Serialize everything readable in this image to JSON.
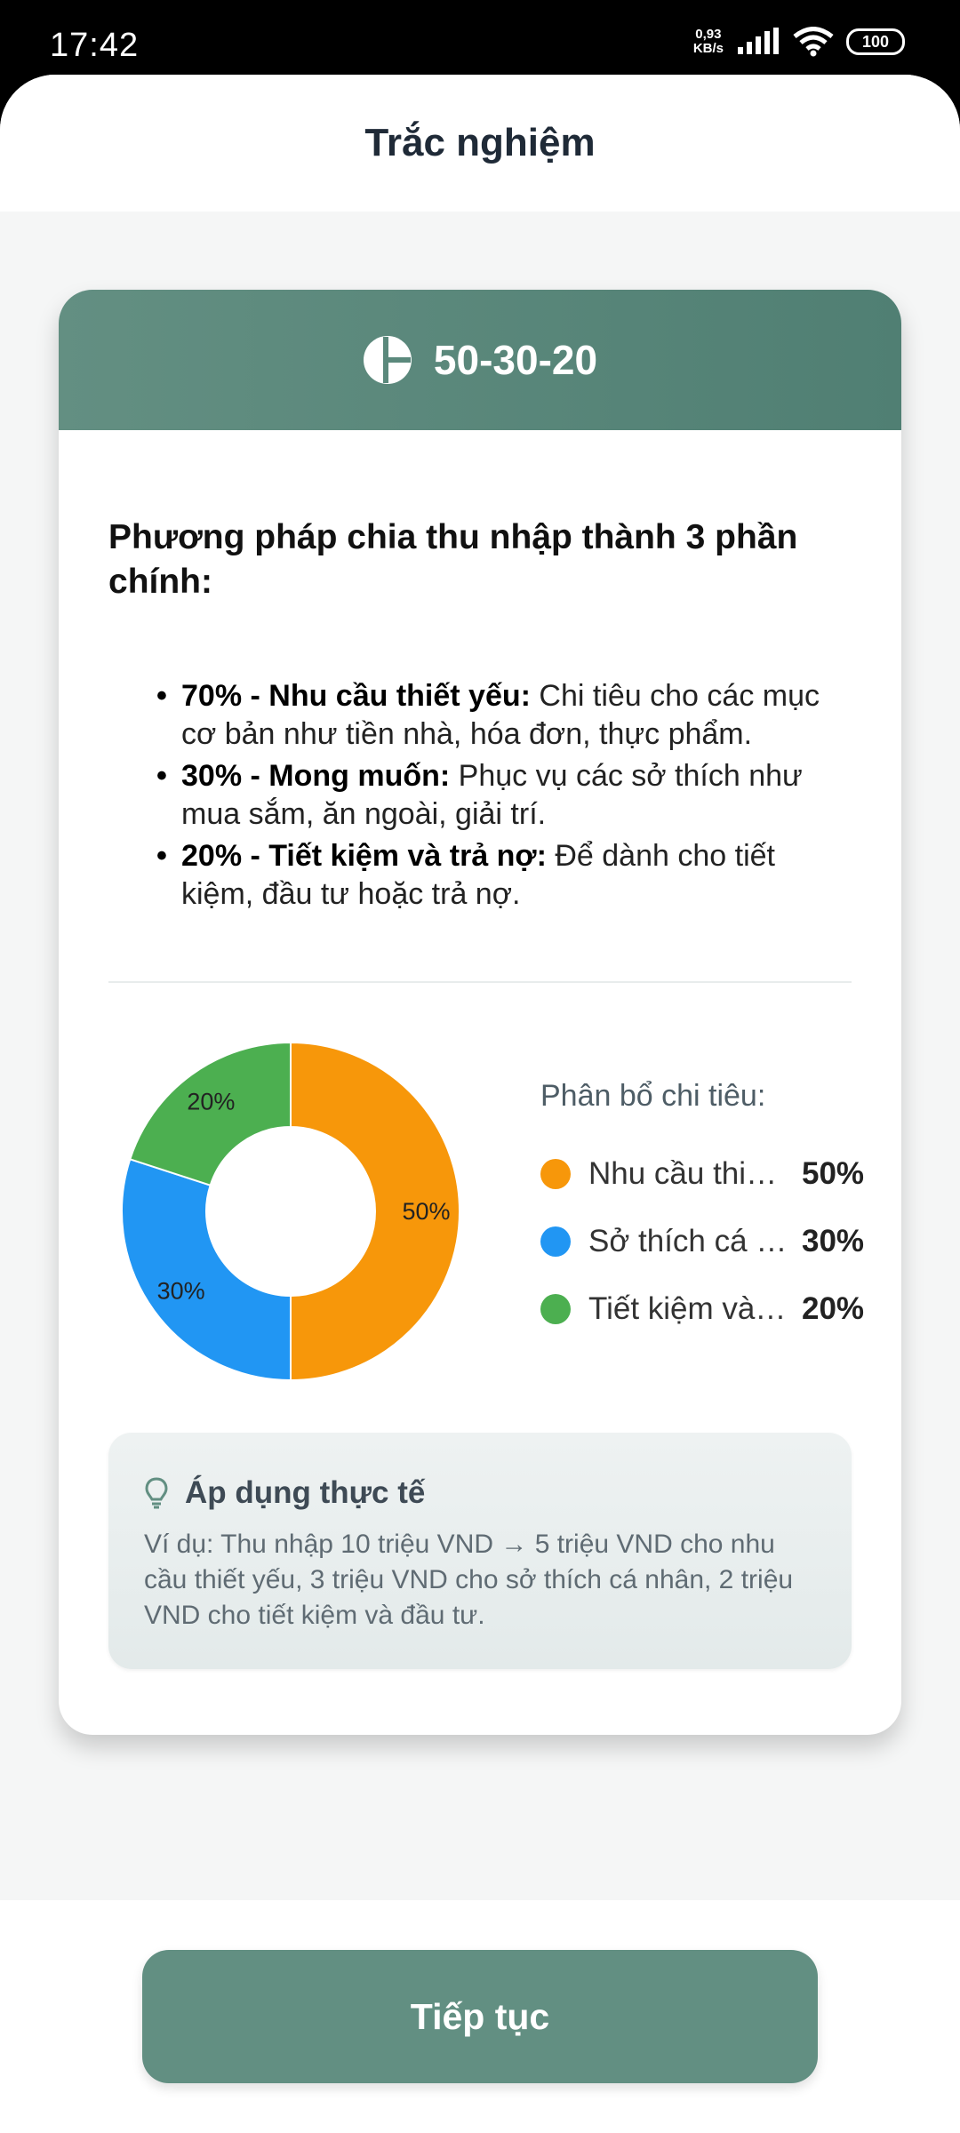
{
  "status_bar": {
    "time": "17:42",
    "net_speed_value": "0,93",
    "net_speed_unit": "KB/s",
    "battery": "100"
  },
  "header": {
    "title": "Trắc nghiệm"
  },
  "card": {
    "title": "50-30-20",
    "icon": "pie-chart-icon",
    "intro": "Phương pháp chia thu nhập thành 3 phần chính:",
    "bullets": [
      {
        "bold": "70% - Nhu cầu thiết yếu:",
        "text": " Chi tiêu cho các mục cơ bản như tiền nhà, hóa đơn, thực phẩm."
      },
      {
        "bold": "30% - Mong muốn:",
        "text": " Phục vụ các sở thích như mua sắm, ăn ngoài, giải trí."
      },
      {
        "bold": "20% - Tiết kiệm và trả nợ:",
        "text": " Để dành cho tiết kiệm, đầu tư hoặc trả nợ."
      }
    ],
    "legend_title": "Phân bổ chi tiêu:",
    "legend": [
      {
        "label": "Nhu cầu thiết ...",
        "value": "50%",
        "color": "#f7970a"
      },
      {
        "label": "Sở thích cá nh...",
        "value": "30%",
        "color": "#2196f3"
      },
      {
        "label": "Tiết kiệm và đ...",
        "value": "20%",
        "color": "#4caf50"
      }
    ],
    "tip": {
      "icon": "lightbulb-icon",
      "title": "Áp dụng thực tế",
      "text": "Ví dụ: Thu nhập 10 triệu VND → 5 triệu VND cho nhu cầu thiết yếu, 3 triệu VND cho sở thích cá nhân, 2 triệu VND cho tiết kiệm và đầu tư."
    }
  },
  "chart_data": {
    "type": "pie",
    "categories": [
      "Nhu cầu thiết ...",
      "Sở thích cá nh...",
      "Tiết kiệm và đ..."
    ],
    "values": [
      50,
      30,
      20
    ],
    "labels": [
      "50%",
      "30%",
      "20%"
    ],
    "colors": [
      "#f7970a",
      "#2196f3",
      "#4caf50"
    ],
    "title": "Phân bổ chi tiêu:"
  },
  "footer": {
    "continue_label": "Tiếp tục"
  }
}
